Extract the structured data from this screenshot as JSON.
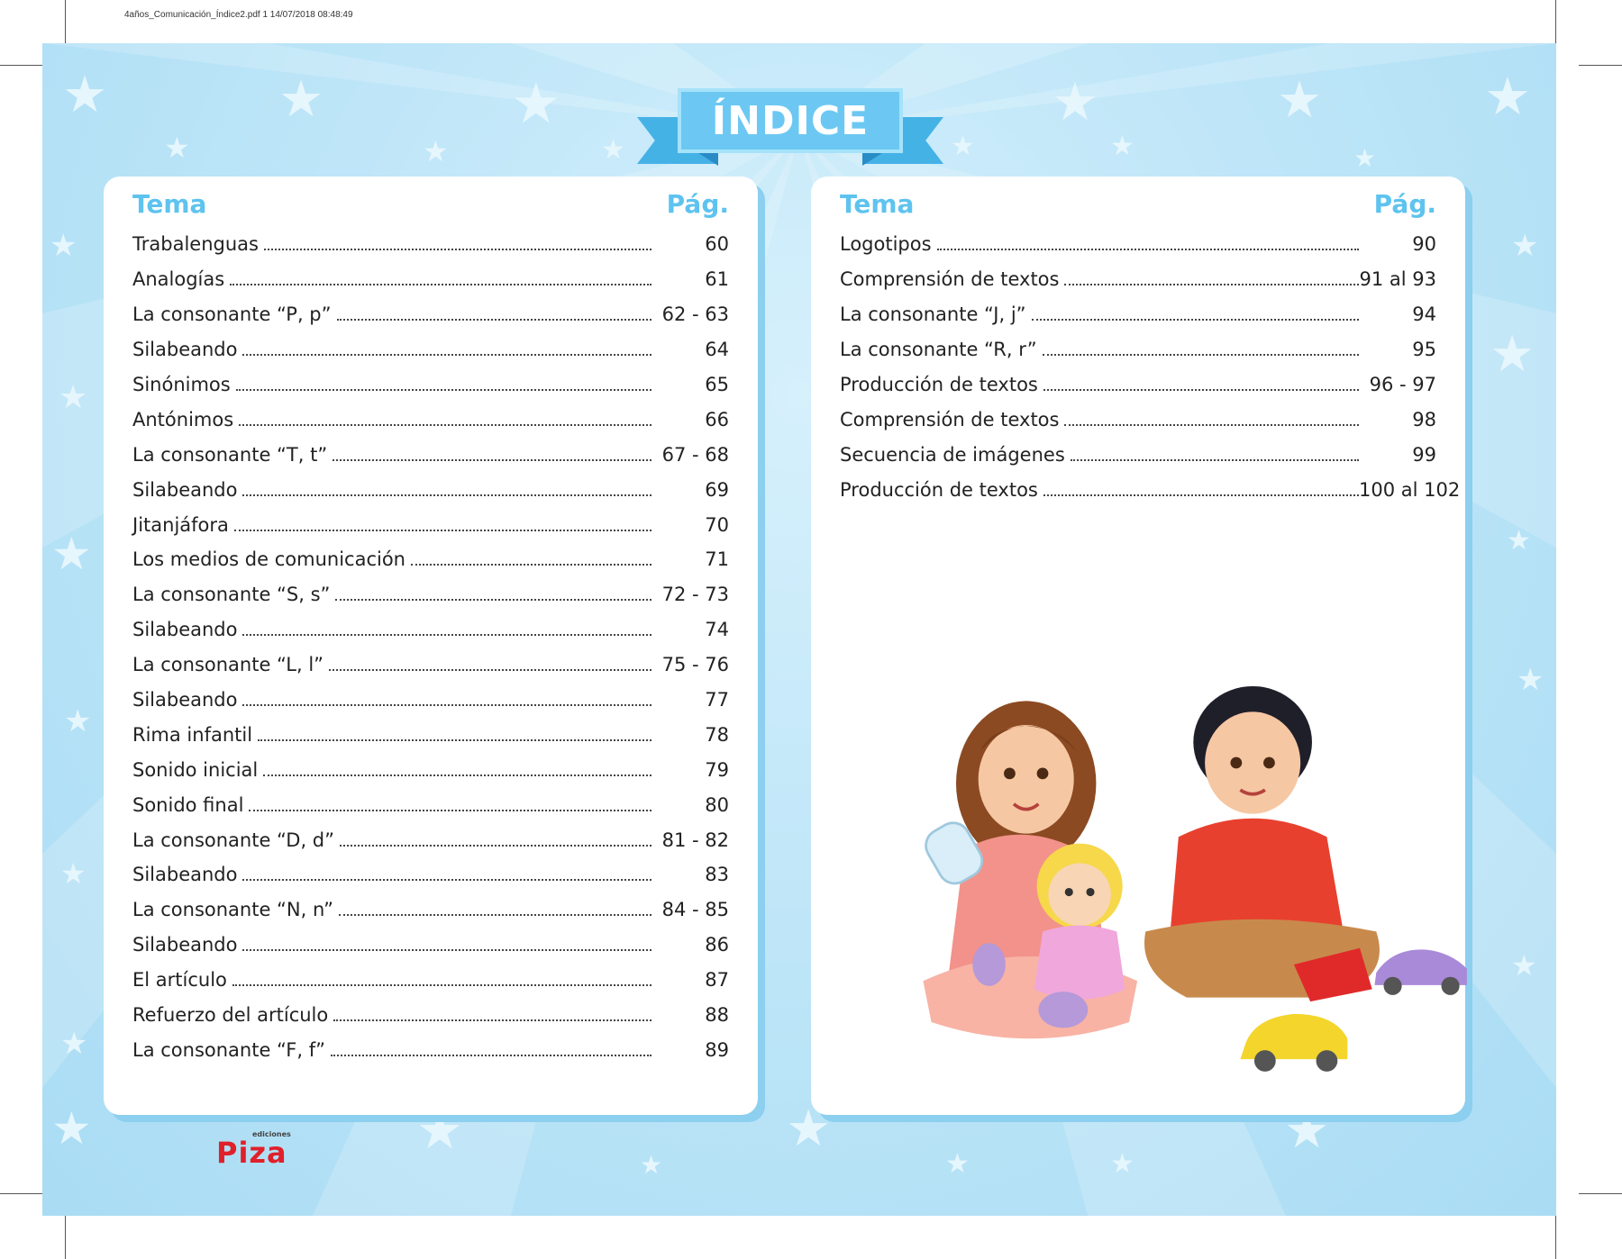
{
  "file_header": "4años_Comunicación_Índice2.pdf   1   14/07/2018   08:48:49",
  "title": "ÍNDICE",
  "left": {
    "tema_label": "Tema",
    "pag_label": "Pág.",
    "items": [
      {
        "topic": "Trabalenguas",
        "page": "60"
      },
      {
        "topic": "Analogías",
        "page": "61"
      },
      {
        "topic": "La consonante “P, p”",
        "page": "62 - 63"
      },
      {
        "topic": "Silabeando",
        "page": "64"
      },
      {
        "topic": "Sinónimos",
        "page": "65"
      },
      {
        "topic": "Antónimos",
        "page": "66"
      },
      {
        "topic": "La consonante “T, t”",
        "page": "67 - 68"
      },
      {
        "topic": "Silabeando",
        "page": "69"
      },
      {
        "topic": "Jitanjáfora",
        "page": "70"
      },
      {
        "topic": "Los medios de comunicación",
        "page": "71"
      },
      {
        "topic": "La consonante “S, s”",
        "page": "72 - 73"
      },
      {
        "topic": "Silabeando",
        "page": "74"
      },
      {
        "topic": "La consonante “L, l”",
        "page": "75 - 76"
      },
      {
        "topic": "Silabeando",
        "page": "77"
      },
      {
        "topic": "Rima infantil",
        "page": "78"
      },
      {
        "topic": "Sonido inicial",
        "page": "79"
      },
      {
        "topic": "Sonido final",
        "page": "80"
      },
      {
        "topic": "La consonante “D, d”",
        "page": "81 - 82"
      },
      {
        "topic": "Silabeando",
        "page": "83"
      },
      {
        "topic": "La consonante “N, n”",
        "page": "84 - 85"
      },
      {
        "topic": "Silabeando",
        "page": "86"
      },
      {
        "topic": "El artículo",
        "page": "87"
      },
      {
        "topic": "Refuerzo del artículo",
        "page": "88"
      },
      {
        "topic": "La consonante “F, f”",
        "page": "89"
      }
    ]
  },
  "right": {
    "tema_label": "Tema",
    "pag_label": "Pág.",
    "items": [
      {
        "topic": "Logotipos",
        "page": "90"
      },
      {
        "topic": "Comprensión de textos",
        "page": "91 al 93"
      },
      {
        "topic": "La consonante “J, j”",
        "page": "94"
      },
      {
        "topic": "La consonante “R, r”",
        "page": "95"
      },
      {
        "topic": "Producción de textos",
        "page": "96 - 97"
      },
      {
        "topic": "Comprensión de textos",
        "page": "98"
      },
      {
        "topic": "Secuencia de imágenes",
        "page": "99"
      },
      {
        "topic": "Producción de textos",
        "page": "100 al 102"
      }
    ]
  },
  "logo": {
    "text": "Piza",
    "small": "ediciones"
  },
  "colors": {
    "background": "#bfe6f8",
    "heading": "#5ec3ef",
    "ribbon": "#6cc8f2",
    "logo": "#e0202a"
  }
}
